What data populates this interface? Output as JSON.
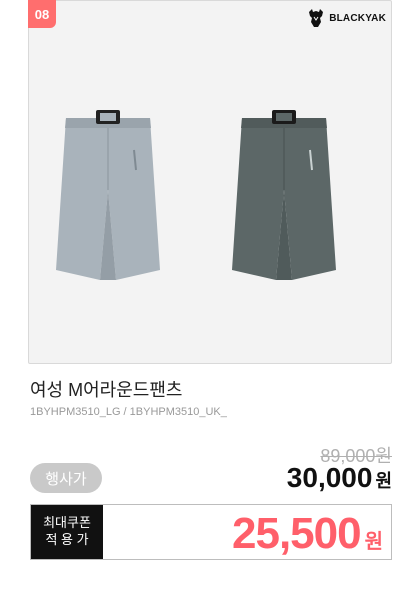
{
  "product": {
    "rank": "08",
    "brand": "BLACKYAK",
    "title": "여성 M어라운드팬츠",
    "codes": "1BYHPM3510_LG / 1BYHPM3510_UK_",
    "original_price": "89,000원",
    "event_label": "행사가",
    "sale_price": "30,000",
    "sale_unit": "원",
    "coupon_line1": "최대쿠폰",
    "coupon_line2": "적 용 가",
    "coupon_price": "25,500",
    "coupon_unit": "원",
    "variants": [
      {
        "name": "light-gray",
        "color": "#a9b3bb"
      },
      {
        "name": "dark-gray",
        "color": "#5c6767"
      }
    ],
    "colors": {
      "badge": "#ff6e6e",
      "coupon_price": "#ff5f6a",
      "coupon_label_bg": "#111111"
    }
  }
}
